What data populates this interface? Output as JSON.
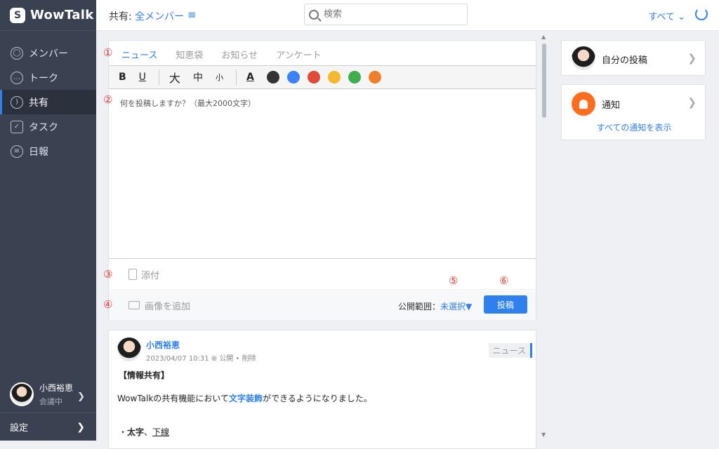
{
  "sidebar": {
    "app_name": "WowTalk",
    "items": [
      {
        "label": "メンバー",
        "icon": "person-icon"
      },
      {
        "label": "トーク",
        "icon": "chat-icon"
      },
      {
        "label": "共有",
        "icon": "feed-icon"
      },
      {
        "label": "タスク",
        "icon": "clipboard-icon"
      },
      {
        "label": "日報",
        "icon": "report-icon"
      }
    ],
    "active_index": 2,
    "user": {
      "name": "小西裕恵",
      "status": "会議中"
    },
    "settings_label": "設定"
  },
  "topbar": {
    "share_label": "共有:",
    "share_value": "全メンバー",
    "search_placeholder": "検索",
    "filter_label": "すべて"
  },
  "composer": {
    "tabs": [
      "ニュース",
      "知恵袋",
      "お知らせ",
      "アンケート"
    ],
    "toolbar": {
      "bold": "B",
      "underline": "U",
      "large": "大",
      "medium": "中",
      "small": "小",
      "text_color": "A"
    },
    "colors": [
      "#333333",
      "#3b82f6",
      "#e04b3a",
      "#f5b82e",
      "#3fae4f",
      "#f07f2a"
    ],
    "placeholder": "何を投稿しますか？（最大2000文字）",
    "attach_label": "添付",
    "image_label": "画像を追加",
    "visibility_label": "公開範囲：",
    "visibility_value": "未選択▼",
    "post_button": "投稿",
    "markers": [
      "①",
      "②",
      "③",
      "④",
      "⑤",
      "⑥"
    ]
  },
  "post": {
    "author": "小西裕恵",
    "meta": "2023/04/07 10:31 ⊕ 公開 • 削除",
    "tag": "ニュース",
    "heading": "【情報共有】",
    "body_pre": "WowTalkの共有機能において",
    "body_highlight": "文字装飾",
    "body_post": "ができるようになりました。",
    "list_bullet": "・",
    "list_bold": "太字",
    "list_sep": "、",
    "list_underline": "下線"
  },
  "right": {
    "my_posts": "自分の投稿",
    "notifications": "通知",
    "all_notifications": "すべての通知を表示"
  },
  "colors": {
    "accent": "#2f80ed",
    "sidebar": "#3a4150",
    "marker": "#e53935",
    "notify": "#ff6d1f"
  }
}
